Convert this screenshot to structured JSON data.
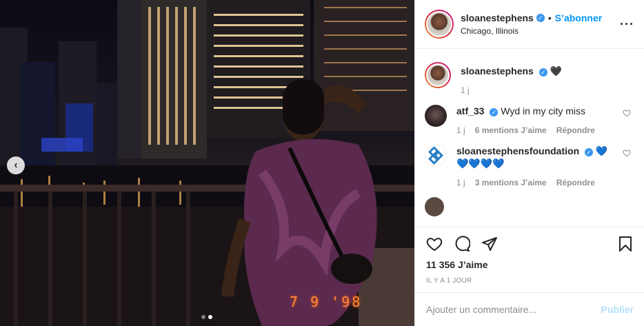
{
  "post": {
    "username": "sloanestephens",
    "follow_label": "S’abonner",
    "separator": "•",
    "location": "Chicago, Illinois",
    "more_icon": "more-horizontal-icon",
    "date_stamp": "7 9 '98"
  },
  "caption": {
    "username": "sloanestephens",
    "emoji": "🖤",
    "time": "1 j"
  },
  "comments": [
    {
      "username": "atf_33",
      "text": "Wyd in my city miss",
      "time": "1 j",
      "likes": "6 mentions J’aime",
      "reply": "Répondre"
    },
    {
      "username": "sloanestephensfoundation",
      "text_inline": "💙",
      "text_line2": "💙💙💙💙",
      "time": "1 j",
      "likes": "3 mentions J’aime",
      "reply": "Répondre"
    }
  ],
  "stats": {
    "likes": "11 356 J’aime",
    "posted": "IL Y A 1 JOUR"
  },
  "composer": {
    "placeholder": "Ajouter un commentaire...",
    "publish_label": "Publier"
  },
  "colors": {
    "accent": "#0095f6",
    "verified": "#3897f0",
    "muted": "#8e8e8e",
    "publish_disabled": "#b2dffc"
  },
  "carousel": {
    "current": 2,
    "total": 2
  }
}
